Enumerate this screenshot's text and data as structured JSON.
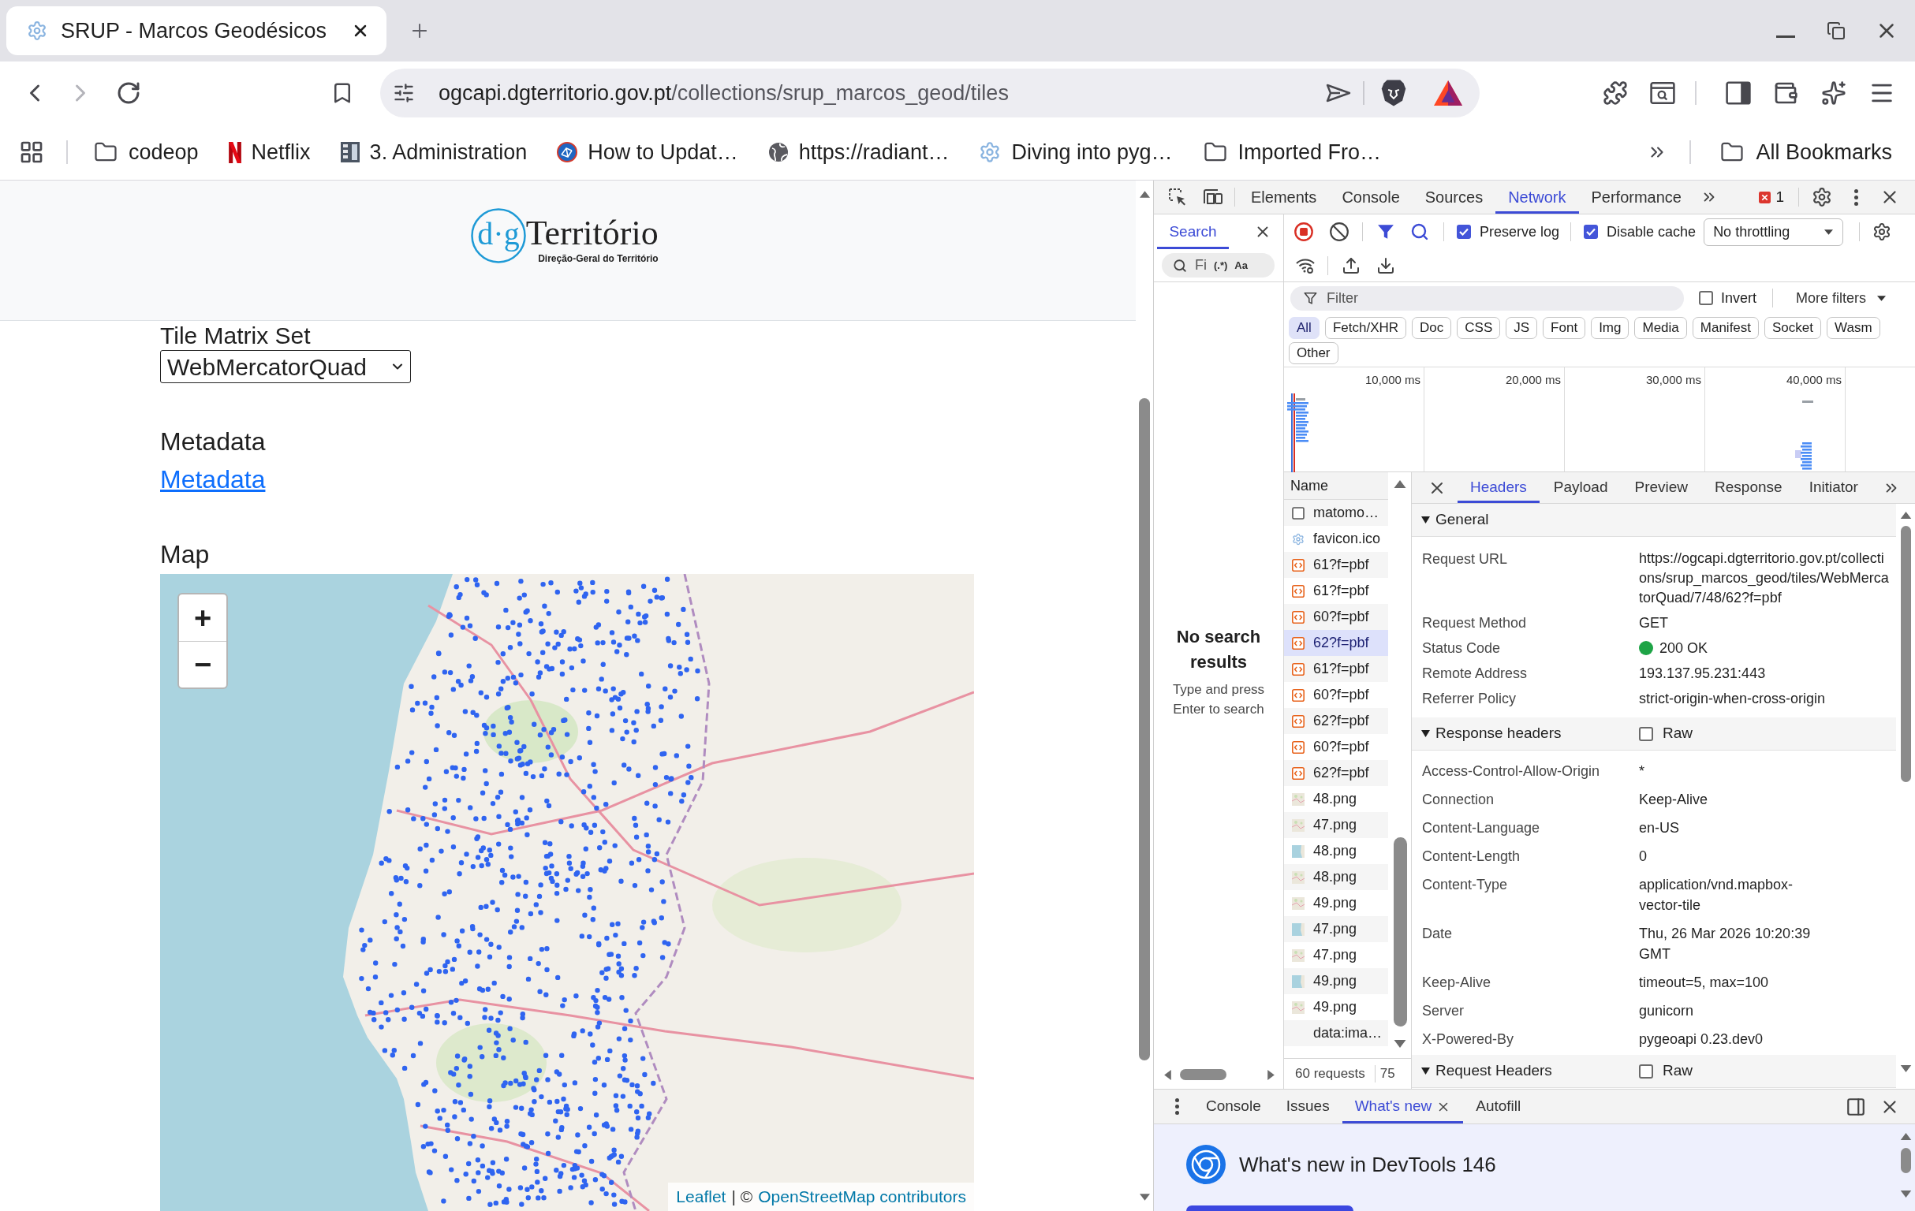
{
  "browser": {
    "tabs": [
      {
        "title": "SRUP - Marcos Geodésicos",
        "selected": true
      }
    ],
    "forward": {
      "disabled": true
    },
    "address_bar": {
      "host": "ogcapi.dgterritorio.gov.pt",
      "path": "/collections/srup_marcos_geod/tiles"
    },
    "bookmarks": [
      {
        "label": "codeop",
        "kind": "folder"
      },
      {
        "label": "Netflix",
        "kind": "netflix"
      },
      {
        "label": "3. Administration",
        "kind": "building"
      },
      {
        "label": "How to Updat…",
        "kind": "site"
      },
      {
        "label": "https://radiant…",
        "kind": "globe"
      },
      {
        "label": "Diving into pyg…",
        "kind": "gear"
      },
      {
        "label": "Imported Fro…",
        "kind": "folder"
      }
    ],
    "all_bookmarks": "All Bookmarks"
  },
  "page": {
    "logo": {
      "prefix": "d·g",
      "name": "Território",
      "tagline": "Direção-Geral do Território"
    },
    "tile_matrix_set": {
      "label": "Tile Matrix Set",
      "value": "WebMercatorQuad"
    },
    "metadata": {
      "heading": "Metadata",
      "link": "Metadata"
    },
    "map": {
      "heading": "Map",
      "zoom_in": "+",
      "zoom_out": "−",
      "attribution": {
        "leaflet": "Leaflet",
        "separator": "| ©",
        "osm": "OpenStreetMap contributors"
      }
    }
  },
  "devtools": {
    "tabs": [
      {
        "label": "Elements",
        "selected": false
      },
      {
        "label": "Console",
        "selected": false
      },
      {
        "label": "Sources",
        "selected": false
      },
      {
        "label": "Network",
        "selected": true
      },
      {
        "label": "Performance",
        "selected": false
      }
    ],
    "error_count": "1",
    "search": {
      "tab": "Search",
      "placeholder": "Fi",
      "regex": "(.*)",
      "match_case": "Aa",
      "empty_title": "No search results",
      "empty_hint": "Type and press Enter to search"
    },
    "network": {
      "preserve_log": {
        "label": "Preserve log",
        "checked": true
      },
      "disable_cache": {
        "label": "Disable cache",
        "checked": true
      },
      "throttling": "No throttling",
      "filter": {
        "placeholder": "Filter"
      },
      "invert": {
        "label": "Invert",
        "checked": false
      },
      "more_filters": "More filters",
      "types": [
        {
          "label": "All",
          "selected": true
        },
        {
          "label": "Fetch/XHR",
          "selected": false
        },
        {
          "label": "Doc",
          "selected": false
        },
        {
          "label": "CSS",
          "selected": false
        },
        {
          "label": "JS",
          "selected": false
        },
        {
          "label": "Font",
          "selected": false
        },
        {
          "label": "Img",
          "selected": false
        },
        {
          "label": "Media",
          "selected": false
        },
        {
          "label": "Manifest",
          "selected": false
        },
        {
          "label": "Socket",
          "selected": false
        },
        {
          "label": "Wasm",
          "selected": false
        },
        {
          "label": "Other",
          "selected": false
        }
      ],
      "overview_ticks": [
        "10,000 ms",
        "20,000 ms",
        "30,000 ms",
        "40,000 ms"
      ],
      "list_header": "Name",
      "requests": [
        {
          "name": "matomo…",
          "kind": "document",
          "selected": false
        },
        {
          "name": "favicon.ico",
          "kind": "favicon",
          "selected": false
        },
        {
          "name": "61?f=pbf",
          "kind": "vector",
          "selected": false
        },
        {
          "name": "61?f=pbf",
          "kind": "vector",
          "selected": false
        },
        {
          "name": "60?f=pbf",
          "kind": "vector",
          "selected": false
        },
        {
          "name": "62?f=pbf",
          "kind": "vector",
          "selected": true
        },
        {
          "name": "61?f=pbf",
          "kind": "vector",
          "selected": false
        },
        {
          "name": "60?f=pbf",
          "kind": "vector",
          "selected": false
        },
        {
          "name": "62?f=pbf",
          "kind": "vector",
          "selected": false
        },
        {
          "name": "60?f=pbf",
          "kind": "vector",
          "selected": false
        },
        {
          "name": "62?f=pbf",
          "kind": "vector",
          "selected": false
        },
        {
          "name": "48.png",
          "kind": "tile",
          "selected": false
        },
        {
          "name": "47.png",
          "kind": "tile",
          "selected": false
        },
        {
          "name": "48.png",
          "kind": "seatile",
          "selected": false
        },
        {
          "name": "48.png",
          "kind": "tile",
          "selected": false
        },
        {
          "name": "49.png",
          "kind": "tile",
          "selected": false
        },
        {
          "name": "47.png",
          "kind": "seatile",
          "selected": false
        },
        {
          "name": "47.png",
          "kind": "tile",
          "selected": false
        },
        {
          "name": "49.png",
          "kind": "seatile",
          "selected": false
        },
        {
          "name": "49.png",
          "kind": "tile",
          "selected": false
        },
        {
          "name": "data:ima…",
          "kind": "data",
          "selected": false
        }
      ],
      "summary": [
        "60 requests",
        "75"
      ]
    },
    "details": {
      "tabs": [
        {
          "label": "Headers",
          "selected": true
        },
        {
          "label": "Payload",
          "selected": false
        },
        {
          "label": "Preview",
          "selected": false
        },
        {
          "label": "Response",
          "selected": false
        },
        {
          "label": "Initiator",
          "selected": false
        }
      ],
      "sections": [
        {
          "title": "General",
          "expanded": true,
          "rows": [
            {
              "key": "Request URL",
              "value": "https://ogcapi.dgterritorio.gov.pt/collections/srup_marcos_geod/tiles/WebMercatorQuad/7/48/62?f=pbf",
              "kind": "url"
            },
            {
              "key": "Request Method",
              "value": "GET",
              "kind": "text"
            },
            {
              "key": "Status Code",
              "value": "200 OK",
              "kind": "status",
              "color": "#1ea446"
            },
            {
              "key": "Remote Address",
              "value": "193.137.95.231:443",
              "kind": "text"
            },
            {
              "key": "Referrer Policy",
              "value": "strict-origin-when-cross-origin",
              "kind": "text"
            }
          ]
        },
        {
          "title": "Response headers",
          "expanded": true,
          "raw": {
            "label": "Raw",
            "checked": false
          },
          "rows": [
            {
              "key": "Access-Control-Allow-Origin",
              "value": "*",
              "kind": "text"
            },
            {
              "key": "Connection",
              "value": "Keep-Alive",
              "kind": "text"
            },
            {
              "key": "Content-Language",
              "value": "en-US",
              "kind": "text"
            },
            {
              "key": "Content-Length",
              "value": "0",
              "kind": "text"
            },
            {
              "key": "Content-Type",
              "value": "application/vnd.mapbox-vector-tile",
              "kind": "text"
            },
            {
              "key": "Date",
              "value": "Thu, 26 Mar 2026 10:20:39 GMT",
              "kind": "text"
            },
            {
              "key": "Keep-Alive",
              "value": "timeout=5, max=100",
              "kind": "text"
            },
            {
              "key": "Server",
              "value": "gunicorn",
              "kind": "text"
            },
            {
              "key": "X-Powered-By",
              "value": "pygeoapi 0.23.dev0",
              "kind": "text"
            }
          ]
        },
        {
          "title": "Request Headers",
          "expanded": true,
          "raw": {
            "label": "Raw",
            "checked": false
          }
        }
      ]
    },
    "drawer": {
      "tabs": [
        {
          "label": "Console",
          "selected": false,
          "closable": false
        },
        {
          "label": "Issues",
          "selected": false,
          "closable": false
        },
        {
          "label": "What's new",
          "selected": true,
          "closable": true
        },
        {
          "label": "Autofill",
          "selected": false,
          "closable": false
        }
      ],
      "whats_new_title": "What's new in DevTools 146"
    }
  }
}
